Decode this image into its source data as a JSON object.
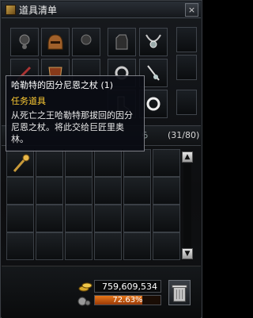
{
  "window": {
    "title": "道具清单",
    "close_symbol": "×"
  },
  "tooltip": {
    "item_name": "哈勒特的因分尼恩之杖 (1)",
    "item_type": "任务道具",
    "description": "从死亡之王哈勒特那拔回的因分尼恩之杖。将此交给巨匠里奥林。"
  },
  "inventory": {
    "tab_marker": "ら",
    "count": "(31/80)"
  },
  "bottom": {
    "adena": "759,609,534",
    "weight": "72.63%",
    "weight_fraction": 0.7263
  },
  "colors": {
    "item_type": "#ffcc33",
    "weight_bar": "#e8781a"
  }
}
